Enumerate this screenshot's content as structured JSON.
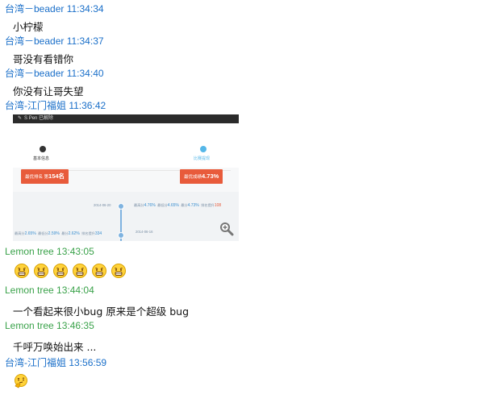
{
  "messages": [
    {
      "sender": "台湾－beader",
      "time": "11:34:34",
      "text": "小柠檬"
    },
    {
      "sender": "台湾－beader",
      "time": "11:34:37",
      "text": "哥没有看错你"
    },
    {
      "sender": "台湾－beader",
      "time": "11:34:40",
      "text": "你没有让哥失望"
    },
    {
      "sender": "台湾-江门福姐",
      "time": "11:36:42"
    },
    {
      "sender": "Lemon tree",
      "time": "13:43:05"
    },
    {
      "sender": "Lemon tree",
      "time": "13:44:04",
      "text": "一个看起来很小bug 原来是个超级 bug"
    },
    {
      "sender": "Lemon tree",
      "time": "13:46:35",
      "text": "千呼万唤始出来 ..."
    },
    {
      "sender": "台湾-江门福姐",
      "time": "13:56:59"
    }
  ],
  "screenshot": {
    "topbar_text": "S Pen 已解除",
    "step_left": "基本信息",
    "step_right": "比赛提现",
    "btn_left_label": "最优排名 第",
    "btn_left_value": "154名",
    "btn_right_label": "最优成绩",
    "btn_right_value": "4.73%",
    "date_top": "2014-06-20",
    "date_bottom": "2014-06-16",
    "stats_top": [
      {
        "label": "最高分",
        "value": "4.76%"
      },
      {
        "label": "最低分",
        "value": "4.65%"
      },
      {
        "label": "最分",
        "value": "4.73%"
      },
      {
        "label": "排名提升",
        "value": "108"
      }
    ],
    "stats_bottom": [
      {
        "label": "最高分",
        "value": "2.65%"
      },
      {
        "label": "最低分",
        "value": "2.59%"
      },
      {
        "label": "最分",
        "value": "2.62%"
      },
      {
        "label": "排名提升",
        "value": "334"
      }
    ]
  },
  "emoji_row_count": 6,
  "icons": {
    "zoom": "zoom-in-icon",
    "grin": "grinning-face-icon",
    "think": "thinking-face-icon"
  }
}
